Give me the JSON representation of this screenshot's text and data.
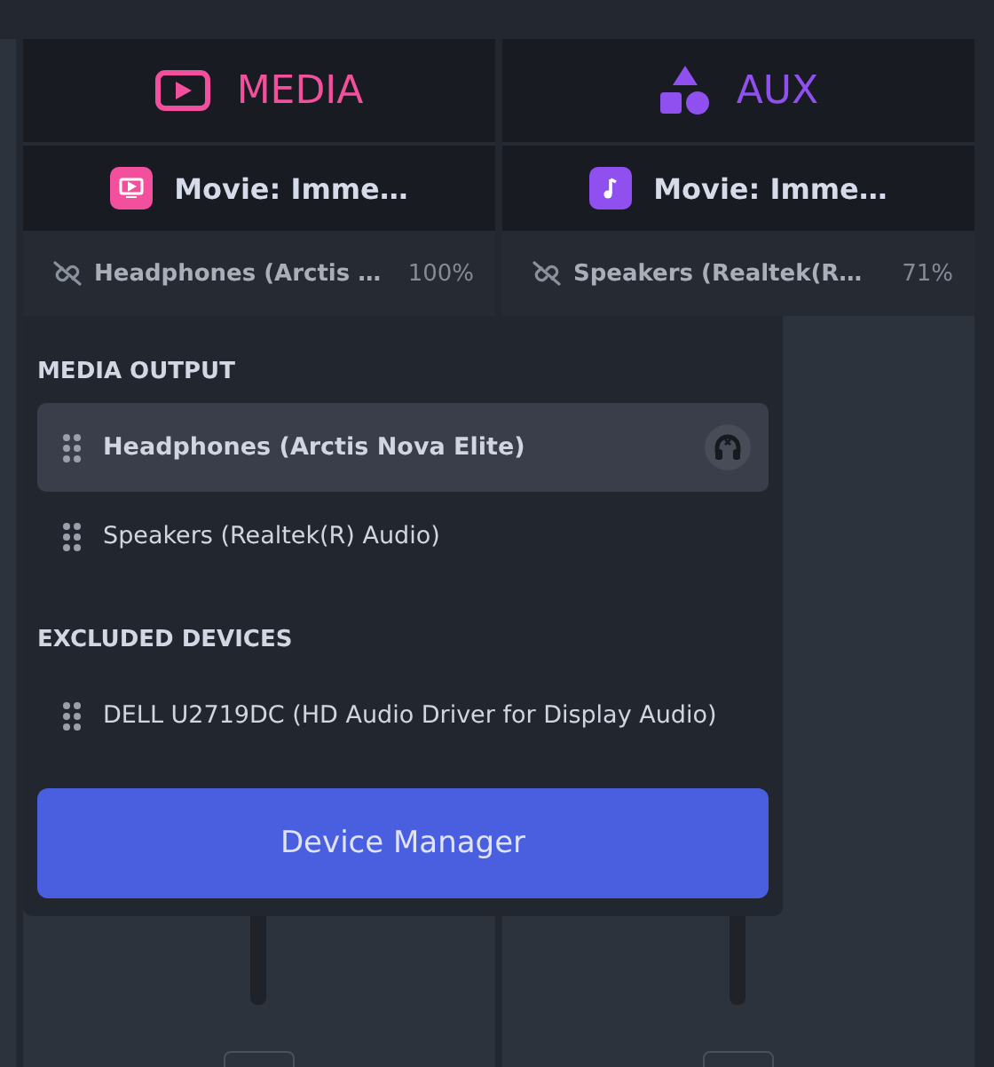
{
  "columns": [
    {
      "title": "MEDIA",
      "kind": "media",
      "color": "#f2509c",
      "app": "Movie: Imme…",
      "device": "Headphones (Arctis …",
      "volume": "100%"
    },
    {
      "title": "AUX",
      "kind": "aux",
      "color": "#9050f0",
      "app": "Movie: Imme…",
      "device": "Speakers (Realtek(R…",
      "volume": "71%"
    }
  ],
  "dropdown": {
    "sections": [
      {
        "heading": "MEDIA OUTPUT",
        "items": [
          {
            "label": "Headphones (Arctis Nova Elite)",
            "selected": true
          },
          {
            "label": "Speakers (Realtek(R) Audio)",
            "selected": false
          }
        ]
      },
      {
        "heading": "EXCLUDED DEVICES",
        "items": [
          {
            "label": "DELL U2719DC (HD Audio Driver for Display Audio)",
            "selected": false
          }
        ]
      }
    ],
    "button": "Device Manager"
  }
}
